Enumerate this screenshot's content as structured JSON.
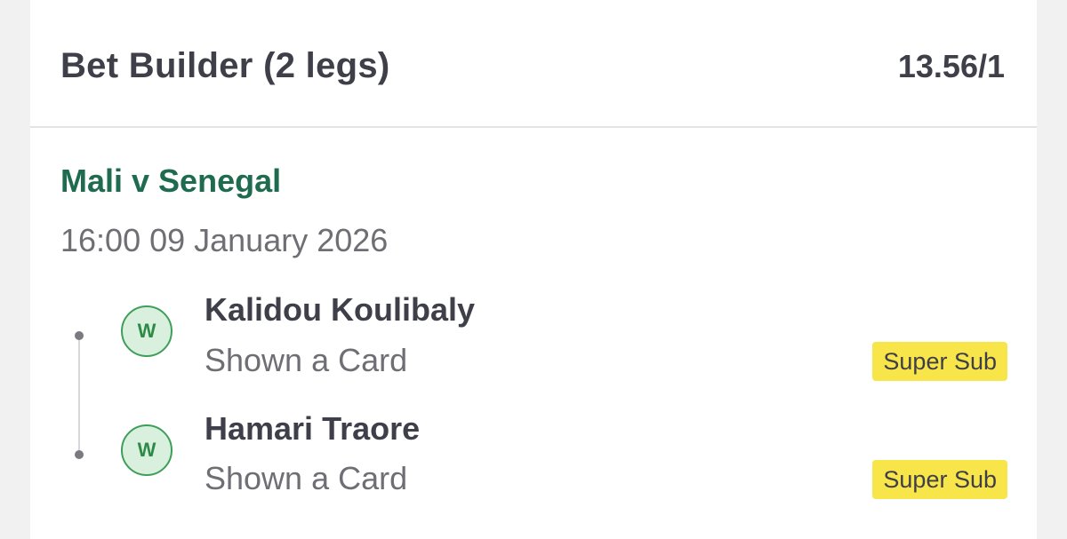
{
  "bet": {
    "title": "Bet Builder (2 legs)",
    "odds": "13.56/1"
  },
  "event": {
    "name": "Mali v Senegal",
    "datetime": "16:00 09 January 2026"
  },
  "legs": [
    {
      "result": "W",
      "player": "Kalidou Koulibaly",
      "market": "Shown a Card",
      "tag": "Super Sub"
    },
    {
      "result": "W",
      "player": "Hamari Traore",
      "market": "Shown a Card",
      "tag": "Super Sub"
    }
  ],
  "colors": {
    "event_name": "#1e6b4f",
    "win_badge_fill": "#d9f0df",
    "win_badge_border": "#3f9e5a",
    "tag_background": "#f7e54a",
    "text_primary": "#3f3f4a",
    "text_secondary": "#6e6e74"
  }
}
